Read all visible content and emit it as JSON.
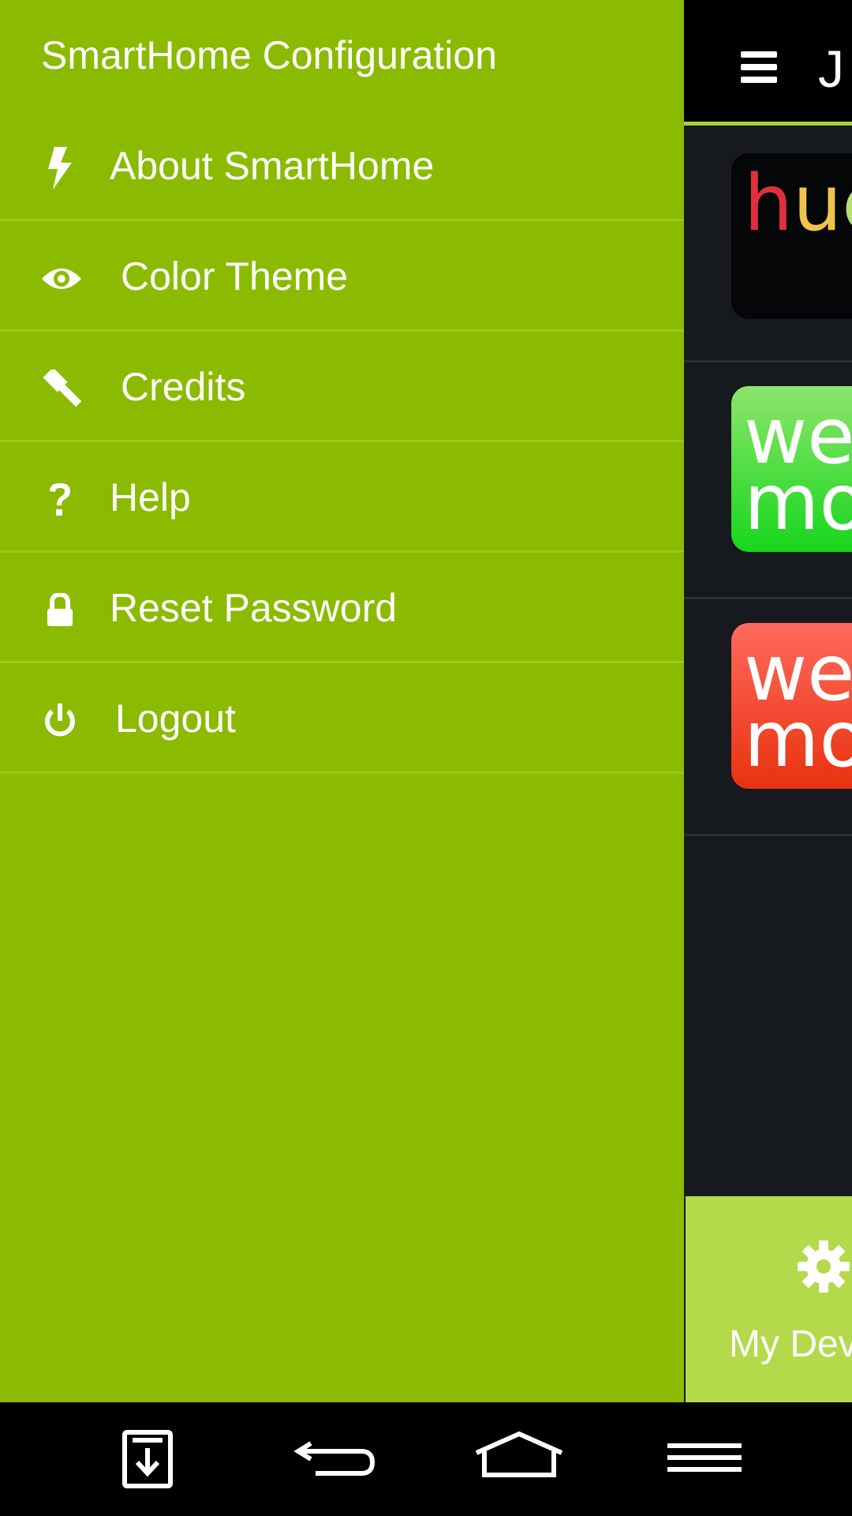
{
  "drawer": {
    "title": "SmartHome Configuration",
    "items": [
      {
        "label": "About SmartHome",
        "icon": "bolt-icon"
      },
      {
        "label": "Color Theme",
        "icon": "eye-icon"
      },
      {
        "label": "Credits",
        "icon": "gavel-icon"
      },
      {
        "label": "Help",
        "icon": "question-icon"
      },
      {
        "label": "Reset Password",
        "icon": "lock-icon"
      },
      {
        "label": "Logout",
        "icon": "power-icon"
      }
    ]
  },
  "app": {
    "title": "J",
    "bottom_tab": {
      "label": "My Dev",
      "icon": "gear-icon"
    }
  },
  "colors": {
    "drawer_bg": "#8bbb00",
    "app_bg": "#16191e",
    "tab_bg": "#b4d94a"
  }
}
